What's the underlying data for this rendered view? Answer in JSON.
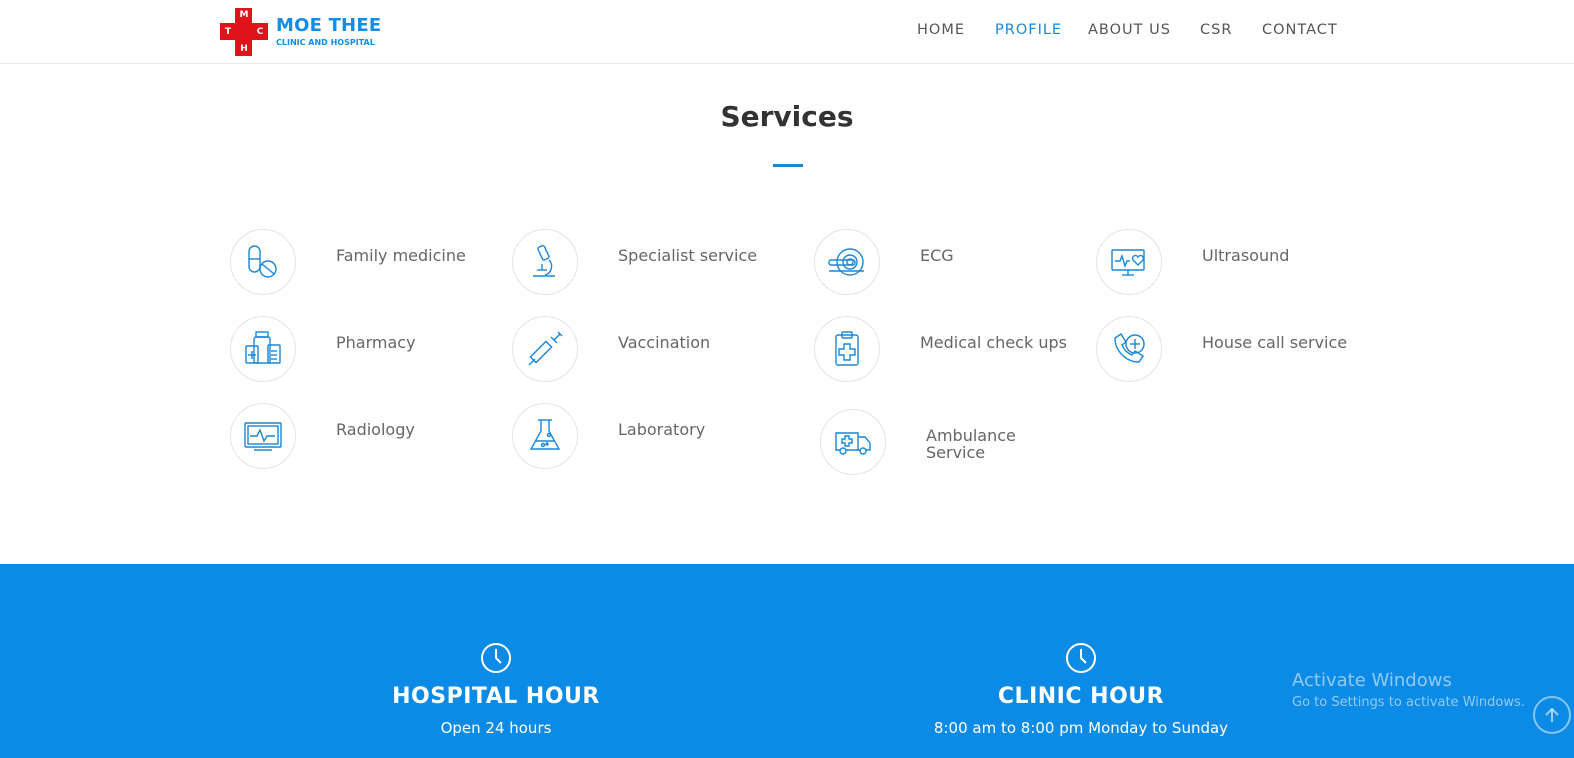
{
  "brand": {
    "letters": [
      "M",
      "T",
      "C",
      "H"
    ],
    "title": "MOE THEE",
    "subtitle": "CLINIC AND HOSPITAL",
    "colors": {
      "cross": "#e0131b",
      "text": "#0e8ee8"
    }
  },
  "nav": {
    "items": [
      "HOME",
      "PROFILE",
      "ABOUT US",
      "CSR",
      "CONTACT"
    ],
    "active": "PROFILE"
  },
  "services": {
    "title": "Services",
    "items": [
      {
        "label": "Family medicine",
        "icon": "pills-icon"
      },
      {
        "label": "Specialist service",
        "icon": "microscope-icon"
      },
      {
        "label": "ECG",
        "icon": "scanner-icon"
      },
      {
        "label": "Ultrasound",
        "icon": "monitor-heart-icon"
      },
      {
        "label": "Pharmacy",
        "icon": "medicine-bottles-icon"
      },
      {
        "label": "Vaccination",
        "icon": "syringe-icon"
      },
      {
        "label": "Medical check ups",
        "icon": "clipboard-cross-icon"
      },
      {
        "label": "House call service",
        "icon": "phone-medical-icon"
      },
      {
        "label": "Radiology",
        "icon": "ecg-monitor-icon"
      },
      {
        "label": "Laboratory",
        "icon": "flask-icon"
      },
      {
        "label": "Ambulance Service",
        "icon": "ambulance-icon"
      }
    ]
  },
  "hours": {
    "hospital": {
      "title": "HOSPITAL   HOUR",
      "text": "Open 24 hours"
    },
    "clinic": {
      "title": "CLINIC   HOUR",
      "text": "8:00 am to 8:00 pm Monday to Sunday"
    }
  },
  "watermark": {
    "line1": "Activate Windows",
    "line2": "Go to Settings to activate Windows."
  },
  "colors": {
    "accent": "#1a87d6",
    "band": "#0b8be5"
  }
}
